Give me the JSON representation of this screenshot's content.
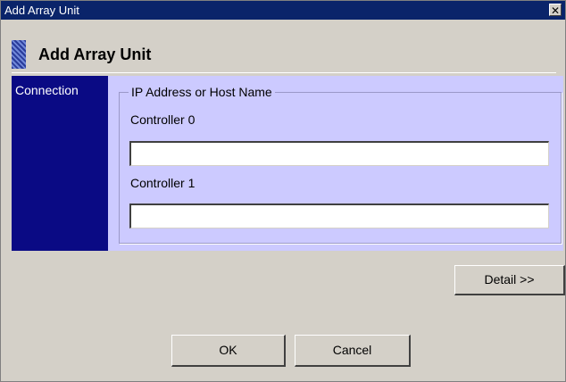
{
  "window": {
    "title": "Add Array Unit",
    "close_glyph": "✕"
  },
  "header": {
    "title": "Add Array Unit",
    "icon": "banner-icon"
  },
  "sidebar": {
    "items": [
      {
        "label": "Connection",
        "selected": true
      }
    ]
  },
  "connection": {
    "group_label": "IP Address or Host Name",
    "fields": [
      {
        "label": "Controller 0",
        "value": "",
        "placeholder": ""
      },
      {
        "label": "Controller 1",
        "value": "",
        "placeholder": ""
      }
    ]
  },
  "buttons": {
    "detail": "Detail >>",
    "ok": "OK",
    "cancel": "Cancel"
  },
  "colors": {
    "titlebar": "#0a246a",
    "sidebar": "#0a0a84",
    "content_bg": "#cccaff",
    "window_bg": "#d4d0c8"
  }
}
